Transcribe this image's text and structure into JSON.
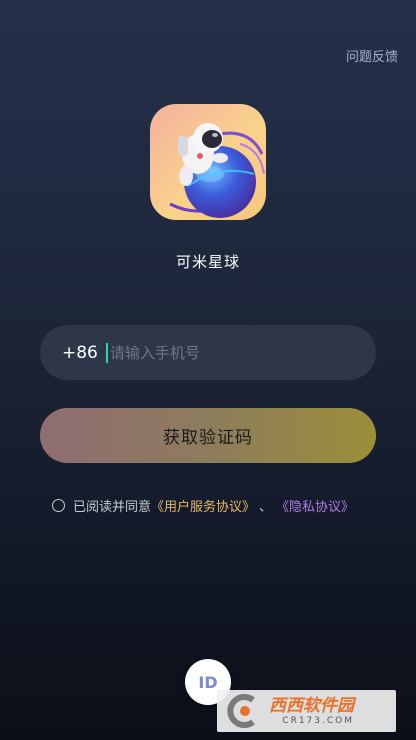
{
  "header": {
    "feedback_label": "问题反馈"
  },
  "app": {
    "name": "可米星球",
    "logo_icon": "astronaut-planet-icon"
  },
  "login": {
    "country_code": "+86",
    "phone_placeholder": "请输入手机号",
    "phone_value": "",
    "get_code_label": "获取验证码"
  },
  "agreement": {
    "checked": false,
    "prefix": "已阅读并同意",
    "terms_label": "《用户服务协议》",
    "separator": "、",
    "privacy_label": "《隐私协议》"
  },
  "id_button": {
    "label": "ID"
  },
  "watermark": {
    "brand_text": "西西软件园",
    "site_text": "CR173.COM"
  },
  "colors": {
    "background_top": "#24304c",
    "background_bottom": "#0b0f18",
    "input_bg": "#2e3649",
    "button_gradient_start": "#8f6d73",
    "button_gradient_end": "#9a9038",
    "terms_link": "#e8b866",
    "privacy_link": "#b07ce6",
    "caret": "#2fd3a8"
  }
}
